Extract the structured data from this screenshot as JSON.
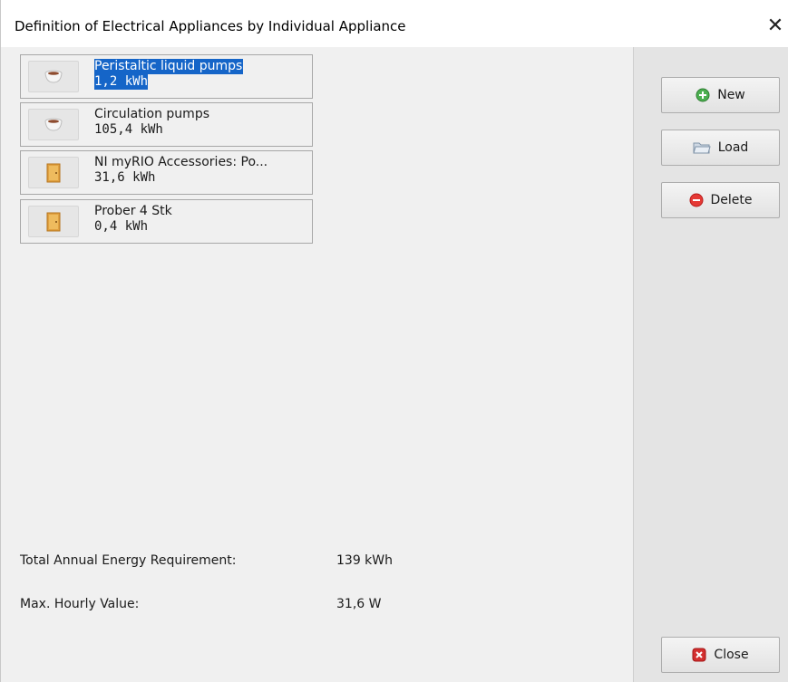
{
  "window": {
    "title": "Definition of Electrical Appliances by Individual Appliance",
    "close_glyph": "✕"
  },
  "appliances": [
    {
      "name": "Peristaltic liquid pumps",
      "value": "1,2 kWh",
      "icon": "cup-icon",
      "selected": true
    },
    {
      "name": "Circulation pumps",
      "value": "105,4 kWh",
      "icon": "cup-icon",
      "selected": false
    },
    {
      "name": "NI myRIO Accessories: Po...",
      "value": "31,6 kWh",
      "icon": "door-icon",
      "selected": false
    },
    {
      "name": "Prober 4 Stk",
      "value": "0,4 kWh",
      "icon": "door-icon",
      "selected": false
    }
  ],
  "stats": {
    "total_label": "Total Annual Energy Requirement:",
    "total_value": "139 kWh",
    "max_label": "Max. Hourly Value:",
    "max_value": "31,6 W"
  },
  "buttons": {
    "new_label": "New",
    "load_label": "Load",
    "delete_label": "Delete",
    "close_label": "Close"
  },
  "colors": {
    "selection": "#1565c8",
    "new_icon": "#4caf50",
    "delete_icon": "#e53935",
    "close_icon": "#d32f2f"
  }
}
